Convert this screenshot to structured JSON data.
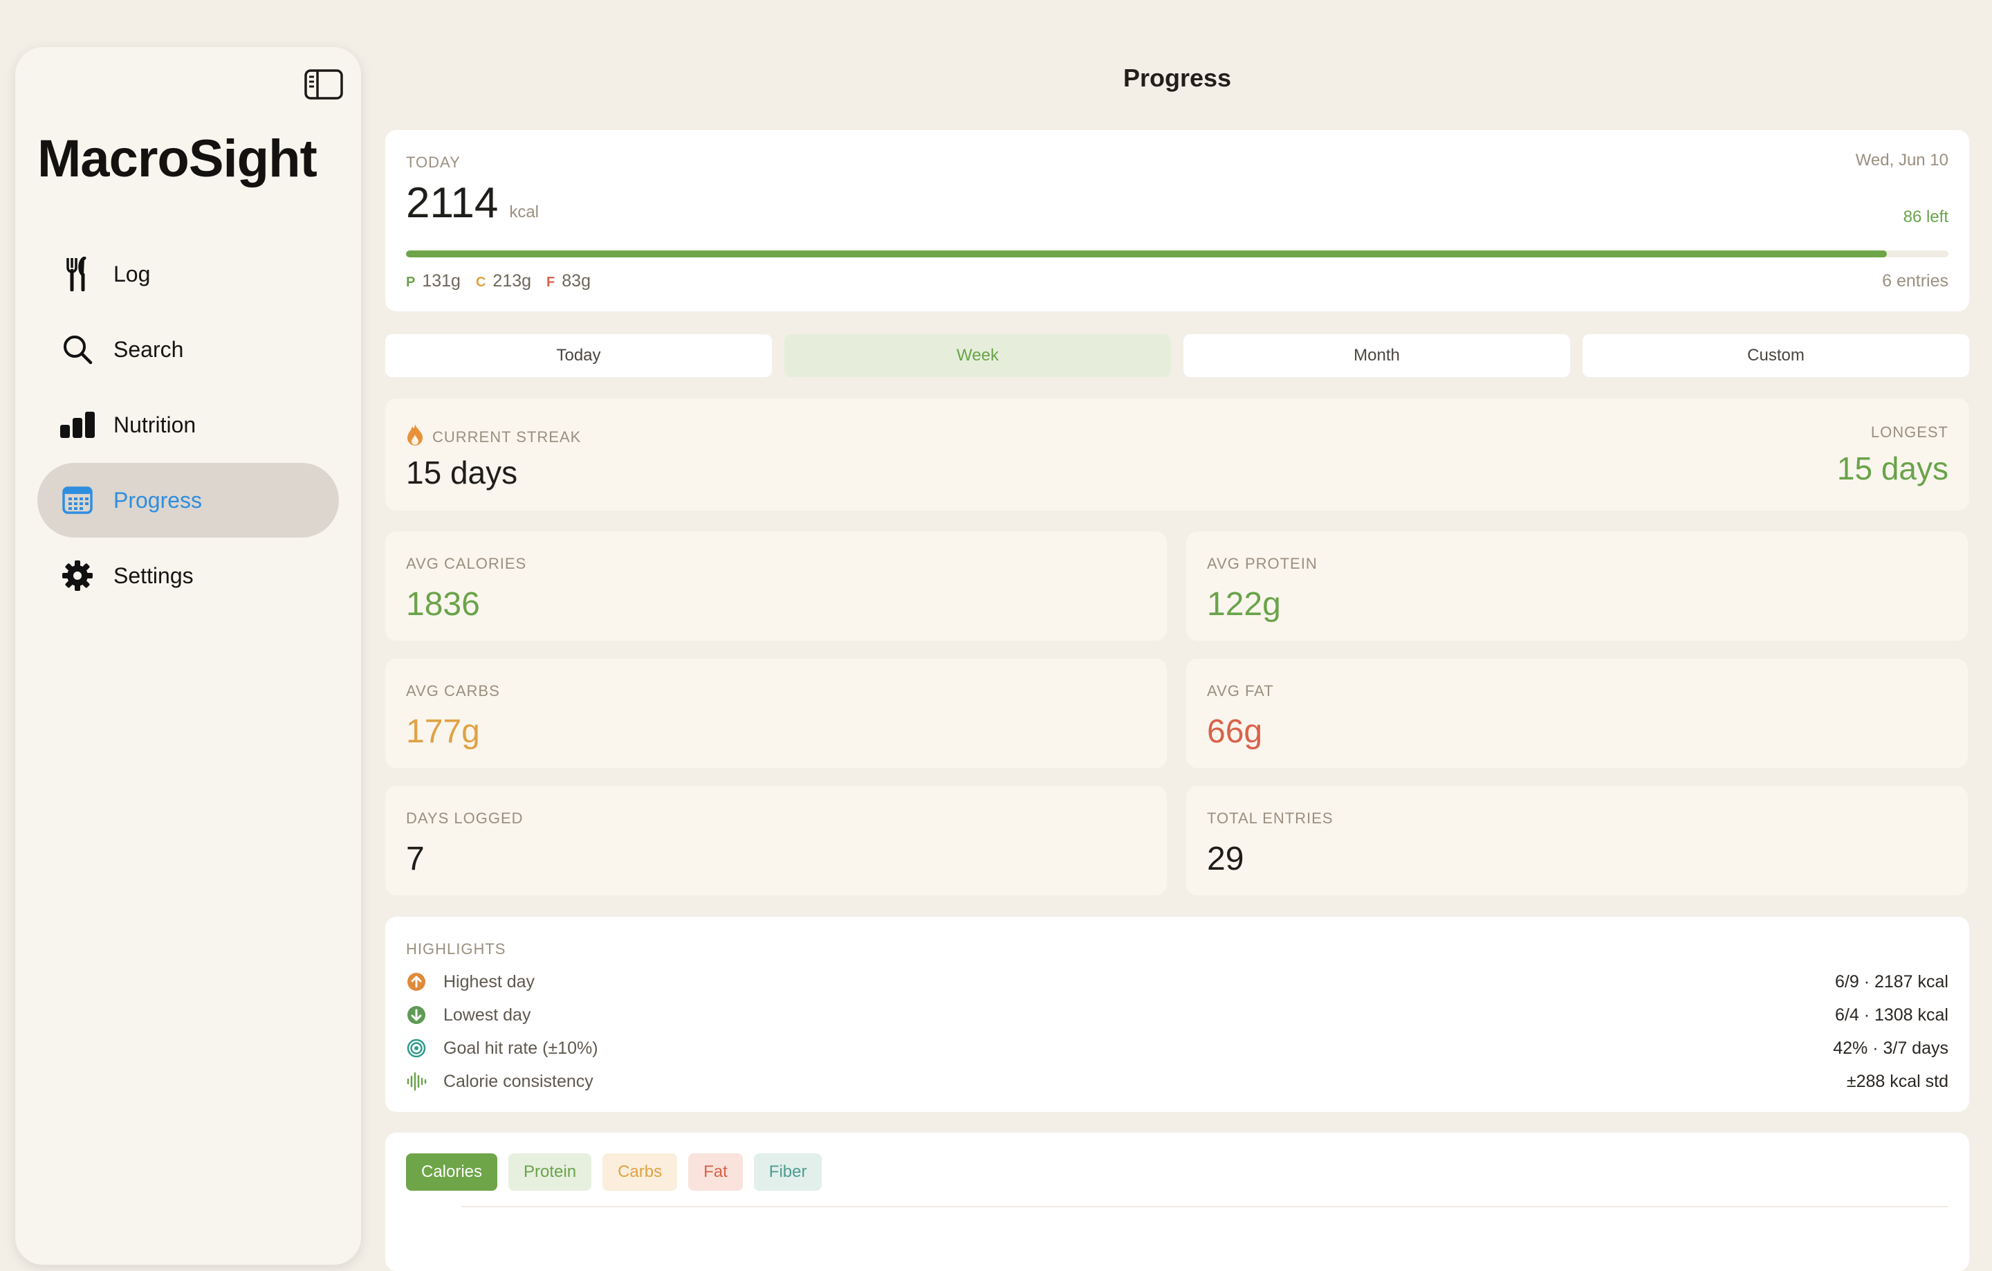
{
  "app": {
    "title": "MacroSight"
  },
  "sidebar": {
    "items": [
      {
        "label": "Log",
        "icon": "fork-knife-icon"
      },
      {
        "label": "Search",
        "icon": "search-icon"
      },
      {
        "label": "Nutrition",
        "icon": "chart-bar-icon"
      },
      {
        "label": "Progress",
        "icon": "calendar-icon",
        "active": true
      },
      {
        "label": "Settings",
        "icon": "gear-icon"
      }
    ]
  },
  "page": {
    "title": "Progress"
  },
  "today": {
    "label": "TODAY",
    "date": "Wed, Jun 10",
    "kcal": "2114",
    "unit": "kcal",
    "remaining": "86 left",
    "progress": 0.96,
    "macros": [
      {
        "letter": "P",
        "value": "131g",
        "color": "#6aa34a"
      },
      {
        "letter": "C",
        "value": "213g",
        "color": "#e0a245"
      },
      {
        "letter": "F",
        "value": "83g",
        "color": "#d9624a"
      }
    ],
    "entries": "6 entries"
  },
  "tabs": [
    {
      "label": "Today"
    },
    {
      "label": "Week",
      "active": true
    },
    {
      "label": "Month"
    },
    {
      "label": "Custom"
    }
  ],
  "streak": {
    "current_label": "CURRENT STREAK",
    "current_value": "15 days",
    "longest_label": "LONGEST",
    "longest_value": "15 days"
  },
  "stats": [
    {
      "label": "AVG CALORIES",
      "value": "1836",
      "color": "#6aa34a"
    },
    {
      "label": "AVG PROTEIN",
      "value": "122g",
      "color": "#6aa34a"
    },
    {
      "label": "AVG CARBS",
      "value": "177g",
      "color": "#e0a245"
    },
    {
      "label": "AVG FAT",
      "value": "66g",
      "color": "#d9624a"
    },
    {
      "label": "DAYS LOGGED",
      "value": "7",
      "color": "#1f1d1a"
    },
    {
      "label": "TOTAL ENTRIES",
      "value": "29",
      "color": "#1f1d1a"
    }
  ],
  "highlights": {
    "title": "HIGHLIGHTS",
    "rows": [
      {
        "label": "Highest day",
        "value": "6/9  ·  2187 kcal",
        "icon": "arrow-up-circle-icon"
      },
      {
        "label": "Lowest day",
        "value": "6/4  ·  1308 kcal",
        "icon": "arrow-down-circle-icon"
      },
      {
        "label": "Goal hit rate (±10%)",
        "value": "42%  ·  3/7 days",
        "icon": "target-icon"
      },
      {
        "label": "Calorie consistency",
        "value": "±288 kcal std",
        "icon": "waveform-icon"
      }
    ]
  },
  "chart_pills": [
    {
      "label": "Calories",
      "active": true
    },
    {
      "label": "Protein"
    },
    {
      "label": "Carbs"
    },
    {
      "label": "Fat"
    },
    {
      "label": "Fiber"
    }
  ]
}
